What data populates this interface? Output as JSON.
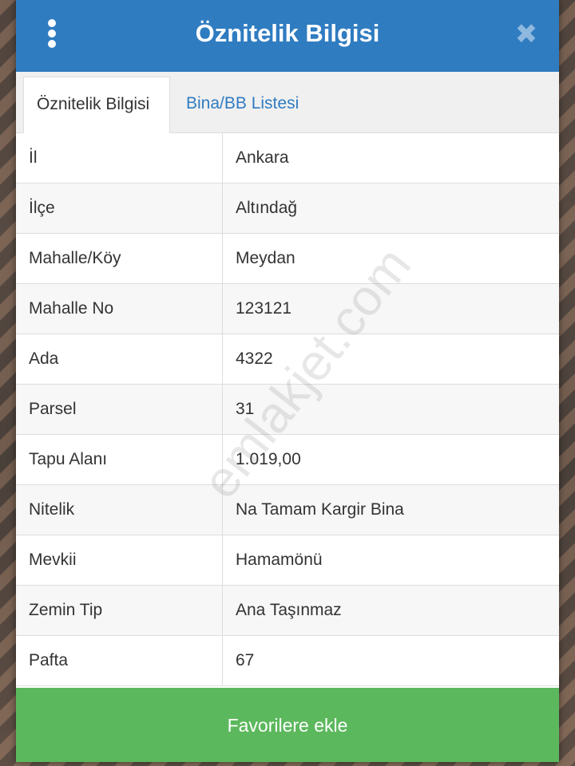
{
  "header": {
    "title": "Öznitelik Bilgisi",
    "close_glyph": "✖"
  },
  "tabs": [
    {
      "label": "Öznitelik Bilgisi",
      "active": true
    },
    {
      "label": "Bina/BB Listesi",
      "active": false
    }
  ],
  "attributes": [
    {
      "label": "İl",
      "value": "Ankara"
    },
    {
      "label": "İlçe",
      "value": "Altındağ"
    },
    {
      "label": "Mahalle/Köy",
      "value": "Meydan"
    },
    {
      "label": "Mahalle No",
      "value": "123121"
    },
    {
      "label": "Ada",
      "value": "4322"
    },
    {
      "label": "Parsel",
      "value": "31"
    },
    {
      "label": "Tapu Alanı",
      "value": "1.019,00"
    },
    {
      "label": "Nitelik",
      "value": "Na Tamam Kargir Bina"
    },
    {
      "label": "Mevkii",
      "value": "Hamamönü"
    },
    {
      "label": "Zemin Tip",
      "value": "Ana Taşınmaz"
    },
    {
      "label": "Pafta",
      "value": "67"
    }
  ],
  "footer": {
    "favorite_label": "Favorilere ekle"
  },
  "watermark": "emlakjet.com",
  "colors": {
    "header_blue": "#2f7cc1",
    "button_green": "#5cb85c"
  }
}
